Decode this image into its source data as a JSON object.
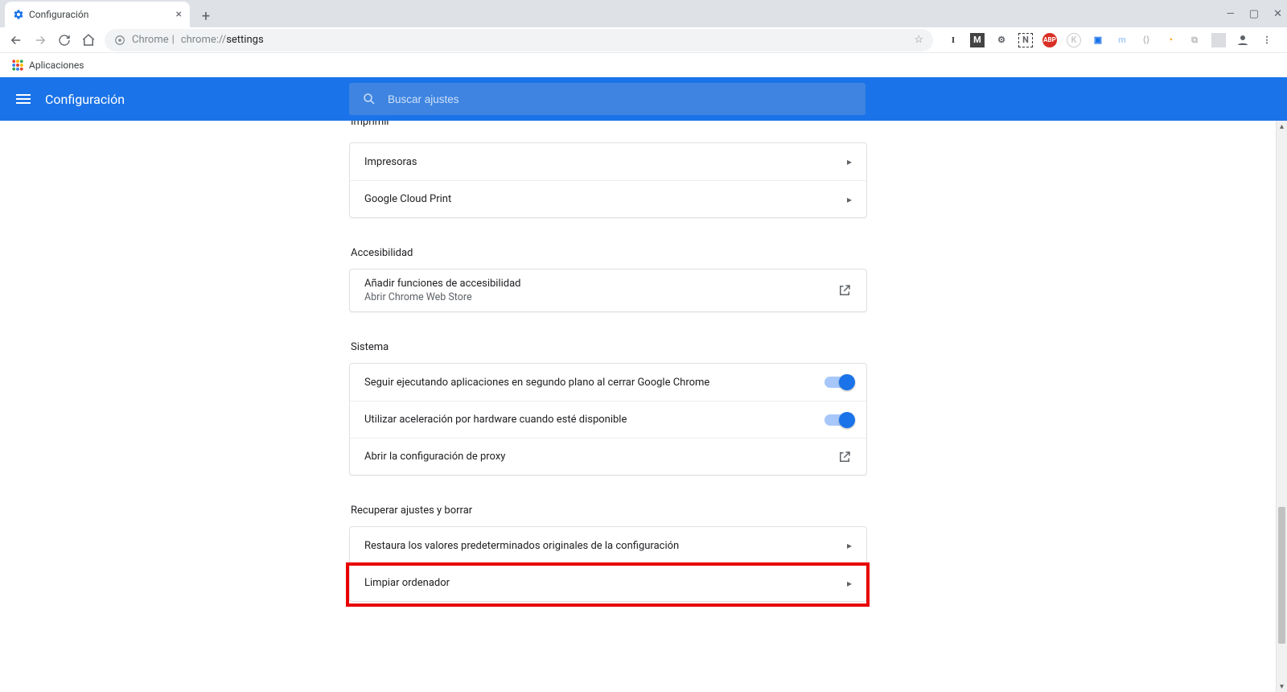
{
  "browser": {
    "tab_title": "Configuración",
    "url_scheme": "Chrome",
    "url_prefix": "chrome://",
    "url_page": "settings",
    "bookmarks_bar_apps": "Aplicaciones"
  },
  "header": {
    "title": "Configuración",
    "search_placeholder": "Buscar ajustes"
  },
  "sections": {
    "print": {
      "title": "Imprimir",
      "items": [
        "Impresoras",
        "Google Cloud Print"
      ]
    },
    "accessibility": {
      "title": "Accesibilidad",
      "item_label": "Añadir funciones de accesibilidad",
      "item_sub": "Abrir Chrome Web Store"
    },
    "system": {
      "title": "Sistema",
      "bg_apps": "Seguir ejecutando aplicaciones en segundo plano al cerrar Google Chrome",
      "hw_accel": "Utilizar aceleración por hardware cuando esté disponible",
      "proxy": "Abrir la configuración de proxy"
    },
    "reset": {
      "title": "Recuperar ajustes y borrar",
      "restore": "Restaura los valores predeterminados originales de la configuración",
      "cleanup": "Limpiar ordenador"
    }
  }
}
